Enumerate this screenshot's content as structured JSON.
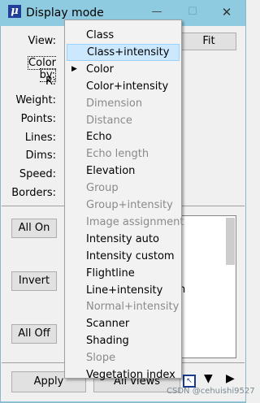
{
  "window": {
    "title": "Display mode",
    "app_icon_glyph": "μ",
    "controls": {
      "minimize": "—",
      "maximize": "☐",
      "close": "✕"
    }
  },
  "form": {
    "labels": {
      "view": "View:",
      "color_by": "Color by:",
      "r": "R:",
      "weight": "Weight:",
      "points": "Points:",
      "lines": "Lines:",
      "dims": "Dims:",
      "speed": "Speed:",
      "borders": "Borders:"
    },
    "fit_button": "Fit",
    "all_on_button": "All On",
    "invert_button": "Invert",
    "all_off_button": "All Off",
    "apply_button": "Apply",
    "all_views_button": "All views",
    "list_partial_text": "n"
  },
  "menu": {
    "items": [
      {
        "label": "Class",
        "enabled": true
      },
      {
        "label": "Class+intensity",
        "enabled": true,
        "highlighted": true
      },
      {
        "label": "Color",
        "enabled": true,
        "checked": true
      },
      {
        "label": "Color+intensity",
        "enabled": true
      },
      {
        "label": "Dimension",
        "enabled": false
      },
      {
        "label": "Distance",
        "enabled": false
      },
      {
        "label": "Echo",
        "enabled": true
      },
      {
        "label": "Echo length",
        "enabled": false
      },
      {
        "label": "Elevation",
        "enabled": true
      },
      {
        "label": "Group",
        "enabled": false
      },
      {
        "label": "Group+intensity",
        "enabled": false
      },
      {
        "label": "Image assignment",
        "enabled": false
      },
      {
        "label": "Intensity auto",
        "enabled": true
      },
      {
        "label": "Intensity custom",
        "enabled": true
      },
      {
        "label": "Flightline",
        "enabled": true
      },
      {
        "label": "Line+intensity",
        "enabled": true
      },
      {
        "label": "Normal+intensity",
        "enabled": false
      },
      {
        "label": "Scanner",
        "enabled": true
      },
      {
        "label": "Shading",
        "enabled": true
      },
      {
        "label": "Slope",
        "enabled": false
      },
      {
        "label": "Vegetation index",
        "enabled": true
      }
    ]
  },
  "toolbar": {
    "tool_icon": "display-tool-icon",
    "down_arrow": "▼",
    "right_arrow": "▶"
  },
  "watermark": "CSDN @cehuishi9527",
  "colors": {
    "titlebar": "#8fcbe0",
    "highlight": "#cce8ff",
    "disabled_text": "#8a8a8a"
  }
}
